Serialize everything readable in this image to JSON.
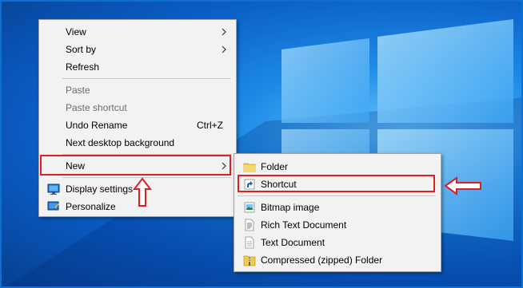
{
  "desktop": {
    "wallpaper": "Windows 10 blue light logo"
  },
  "context_menu": {
    "items": [
      {
        "label": "View",
        "submenu": true
      },
      {
        "label": "Sort by",
        "submenu": true
      },
      {
        "label": "Refresh"
      },
      {
        "label": "Paste",
        "disabled": true
      },
      {
        "label": "Paste shortcut",
        "disabled": true
      },
      {
        "label": "Undo Rename",
        "shortcut": "Ctrl+Z"
      },
      {
        "label": "Next desktop background"
      },
      {
        "label": "New",
        "submenu": true,
        "highlighted": true
      },
      {
        "label": "Display settings",
        "icon": "display-settings-icon"
      },
      {
        "label": "Personalize",
        "icon": "personalize-icon"
      }
    ]
  },
  "new_submenu": {
    "items": [
      {
        "label": "Folder",
        "icon": "folder-icon"
      },
      {
        "label": "Shortcut",
        "icon": "shortcut-icon",
        "highlighted": true
      },
      {
        "label": "Bitmap image",
        "icon": "bitmap-image-icon"
      },
      {
        "label": "Rich Text Document",
        "icon": "rich-text-document-icon"
      },
      {
        "label": "Text Document",
        "icon": "text-document-icon"
      },
      {
        "label": "Compressed (zipped) Folder",
        "icon": "zipped-folder-icon"
      }
    ]
  },
  "annotations": {
    "highlight_color": "#e01c24",
    "up_arrow_target": "New",
    "left_arrow_target": "Shortcut"
  }
}
